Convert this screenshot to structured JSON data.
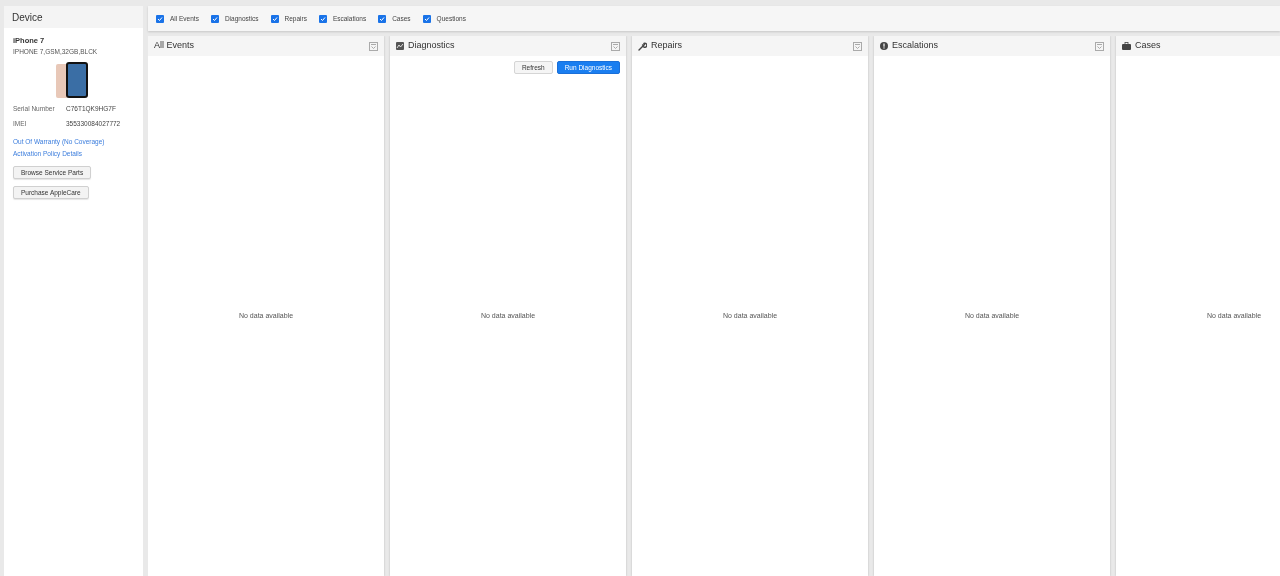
{
  "device": {
    "title": "Device",
    "model": "iPhone 7",
    "config": "IPHONE 7,GSM,32GB,BLCK",
    "fields": [
      {
        "label": "Serial Number",
        "value": "C76T1QK9HG7F"
      },
      {
        "label": "IMEI",
        "value": "355330084027772"
      }
    ],
    "links": [
      "Out Of Warranty (No Coverage)",
      "Activation Policy Details"
    ],
    "buttons": [
      "Browse Service Parts",
      "Purchase AppleCare"
    ]
  },
  "filters": [
    {
      "label": "All Events",
      "checked": true
    },
    {
      "label": "Diagnostics",
      "checked": true
    },
    {
      "label": "Repairs",
      "checked": true
    },
    {
      "label": "Escalations",
      "checked": true
    },
    {
      "label": "Cases",
      "checked": true
    },
    {
      "label": "Questions",
      "checked": true
    }
  ],
  "panels": [
    {
      "title": "All Events",
      "kind": "all",
      "empty": "No data available"
    },
    {
      "title": "Diagnostics",
      "kind": "diagnostics",
      "empty": "No data available",
      "buttons": [
        {
          "label": "Refresh",
          "kind": "secondary"
        },
        {
          "label": "Run Diagnostics",
          "kind": "primary"
        }
      ]
    },
    {
      "title": "Repairs",
      "kind": "repairs",
      "empty": "No data available"
    },
    {
      "title": "Escalations",
      "kind": "escalations",
      "empty": "No data available"
    },
    {
      "title": "Cases",
      "kind": "cases",
      "empty": "No data available"
    }
  ]
}
